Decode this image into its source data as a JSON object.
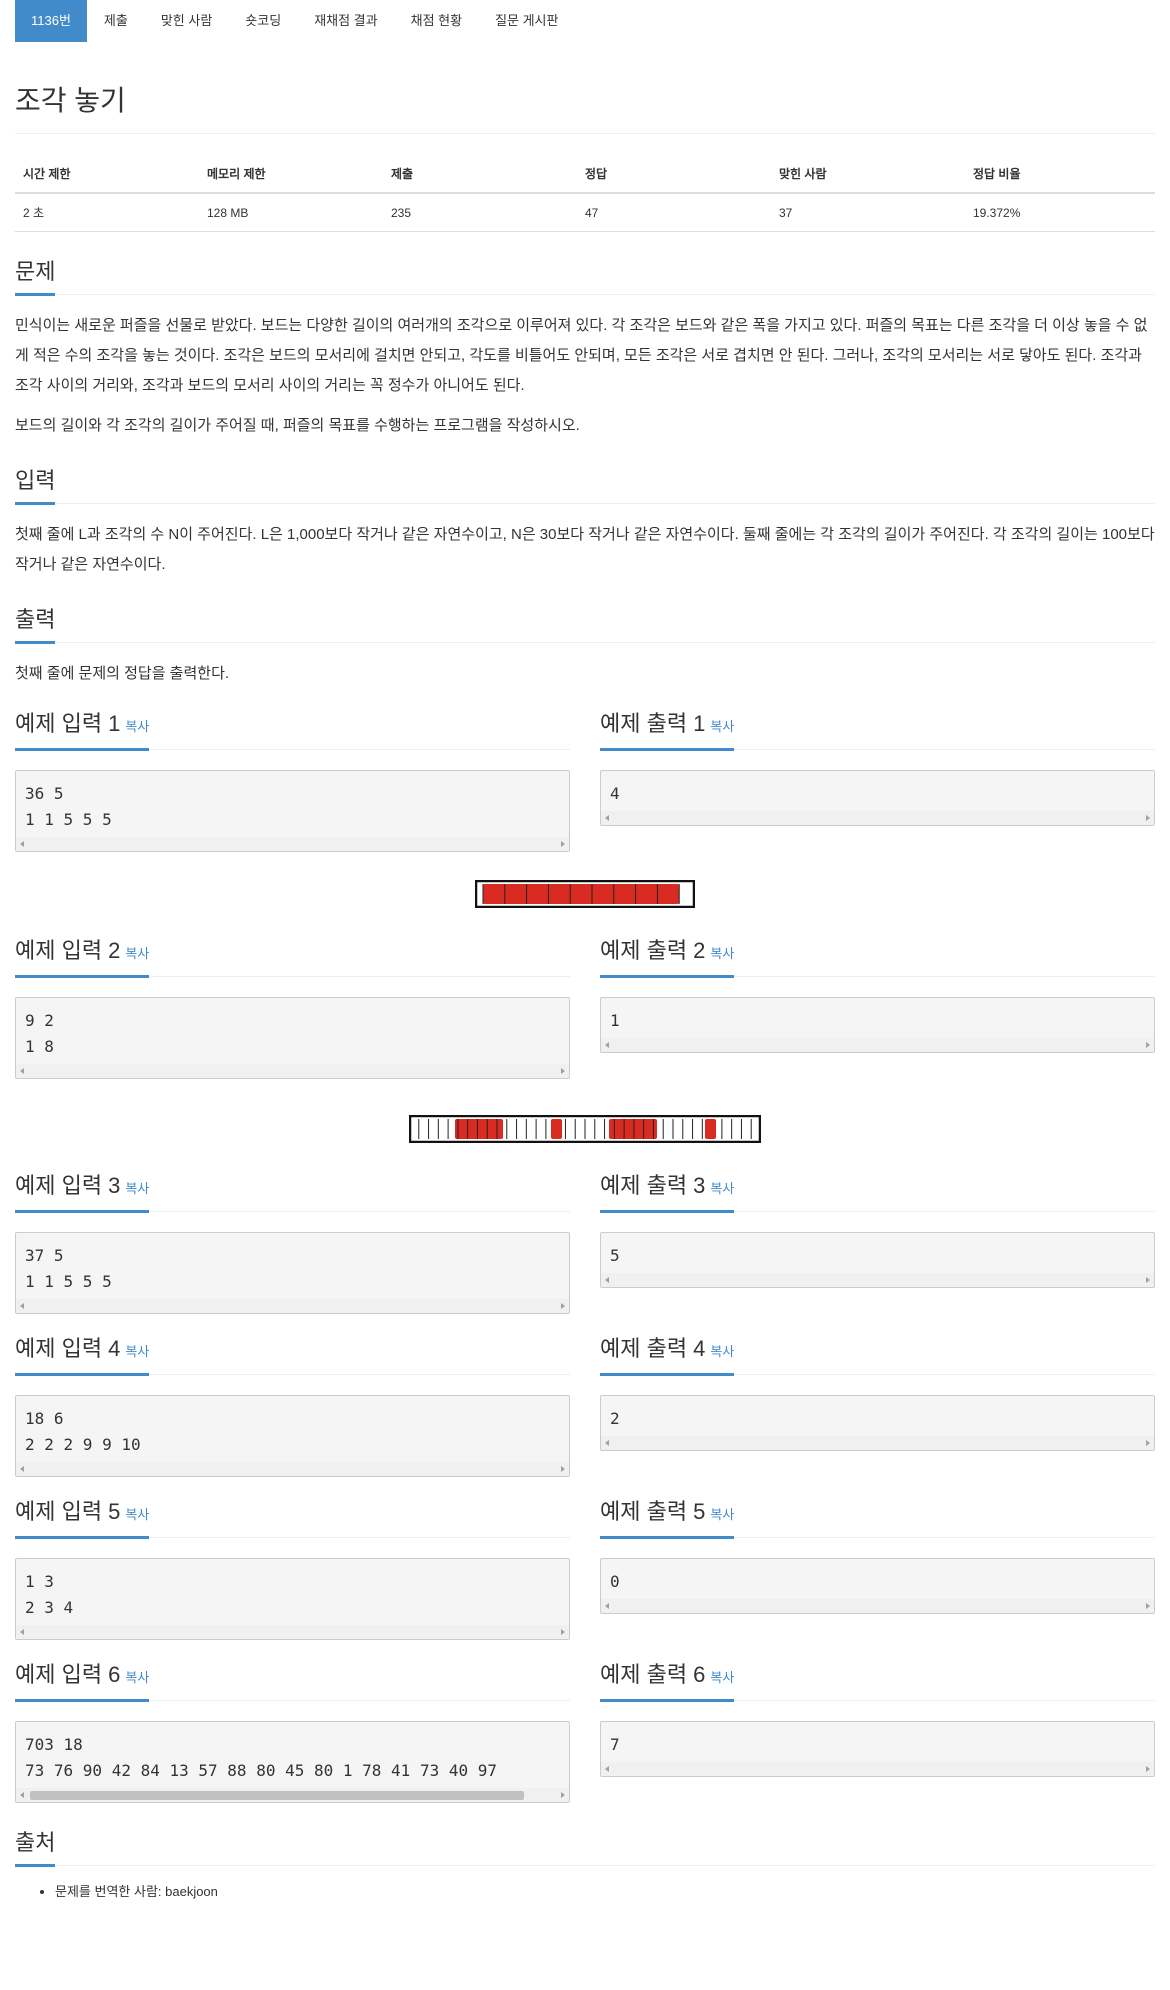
{
  "nav": {
    "items": [
      "1136번",
      "제출",
      "맞힌 사람",
      "숏코딩",
      "재채점 결과",
      "채점 현황",
      "질문 게시판"
    ],
    "active_index": 0,
    "accent": "#428bca"
  },
  "title": "조각 놓기",
  "stats": {
    "headers": [
      "시간 제한",
      "메모리 제한",
      "제출",
      "정답",
      "맞힌 사람",
      "정답 비율"
    ],
    "values": [
      "2 초",
      "128 MB",
      "235",
      "47",
      "37",
      "19.372%"
    ]
  },
  "problem": {
    "heading": "문제",
    "paragraphs": [
      "민식이는 새로운 퍼즐을 선물로 받았다. 보드는 다양한 길이의 여러개의 조각으로 이루어져 있다. 각 조각은 보드와 같은 폭을 가지고 있다. 퍼즐의 목표는 다른 조각을 더 이상 놓을 수 없게 적은 수의 조각을 놓는 것이다. 조각은 보드의 모서리에 걸치면 안되고, 각도를 비틀어도 안되며, 모든 조각은 서로 겹치면 안 된다. 그러나, 조각의 모서리는 서로 닿아도 된다. 조각과 조각 사이의 거리와, 조각과 보드의 모서리 사이의 거리는 꼭 정수가 아니어도 된다.",
      "보드의 길이와 각 조각의 길이가 주어질 때, 퍼즐의 목표를 수행하는 프로그램을 작성하시오."
    ]
  },
  "input": {
    "heading": "입력",
    "text": "첫째 줄에 L과 조각의 수 N이 주어진다. L은 1,000보다 작거나 같은 자연수이고, N은 30보다 작거나 같은 자연수이다. 둘째 줄에는 각 조각의 길이가 주어진다. 각 조각의 길이는 100보다 작거나 같은 자연수이다."
  },
  "output": {
    "heading": "출력",
    "text": "첫째 줄에 문제의 정답을 출력한다."
  },
  "copy_label": "복사",
  "samples": [
    {
      "in_title": "예제 입력 1",
      "out_title": "예제 출력 1",
      "input": "36 5\n1 1 5 5 5",
      "output": "4"
    },
    {
      "in_title": "예제 입력 2",
      "out_title": "예제 출력 2",
      "input": "9 2\n1 8",
      "output": "1"
    },
    {
      "in_title": "예제 입력 3",
      "out_title": "예제 출력 3",
      "input": "37 5\n1 1 5 5 5",
      "output": "5"
    },
    {
      "in_title": "예제 입력 4",
      "out_title": "예제 출력 4",
      "input": "18 6\n2 2 2 9 9 10",
      "output": "2"
    },
    {
      "in_title": "예제 입력 5",
      "out_title": "예제 출력 5",
      "input": "1 3\n2 3 4",
      "output": "0"
    },
    {
      "in_title": "예제 입력 6",
      "out_title": "예제 출력 6",
      "input": "703 18\n73 76 90 42 84 13 57 88 80 45 80 1 78 41 73 40 97",
      "output": "7"
    }
  ],
  "source": {
    "heading": "출처",
    "items": [
      "문제를 번역한 사람: baekjoon"
    ]
  },
  "colors": {
    "piece": "#d92b22",
    "board_border": "#111111"
  }
}
